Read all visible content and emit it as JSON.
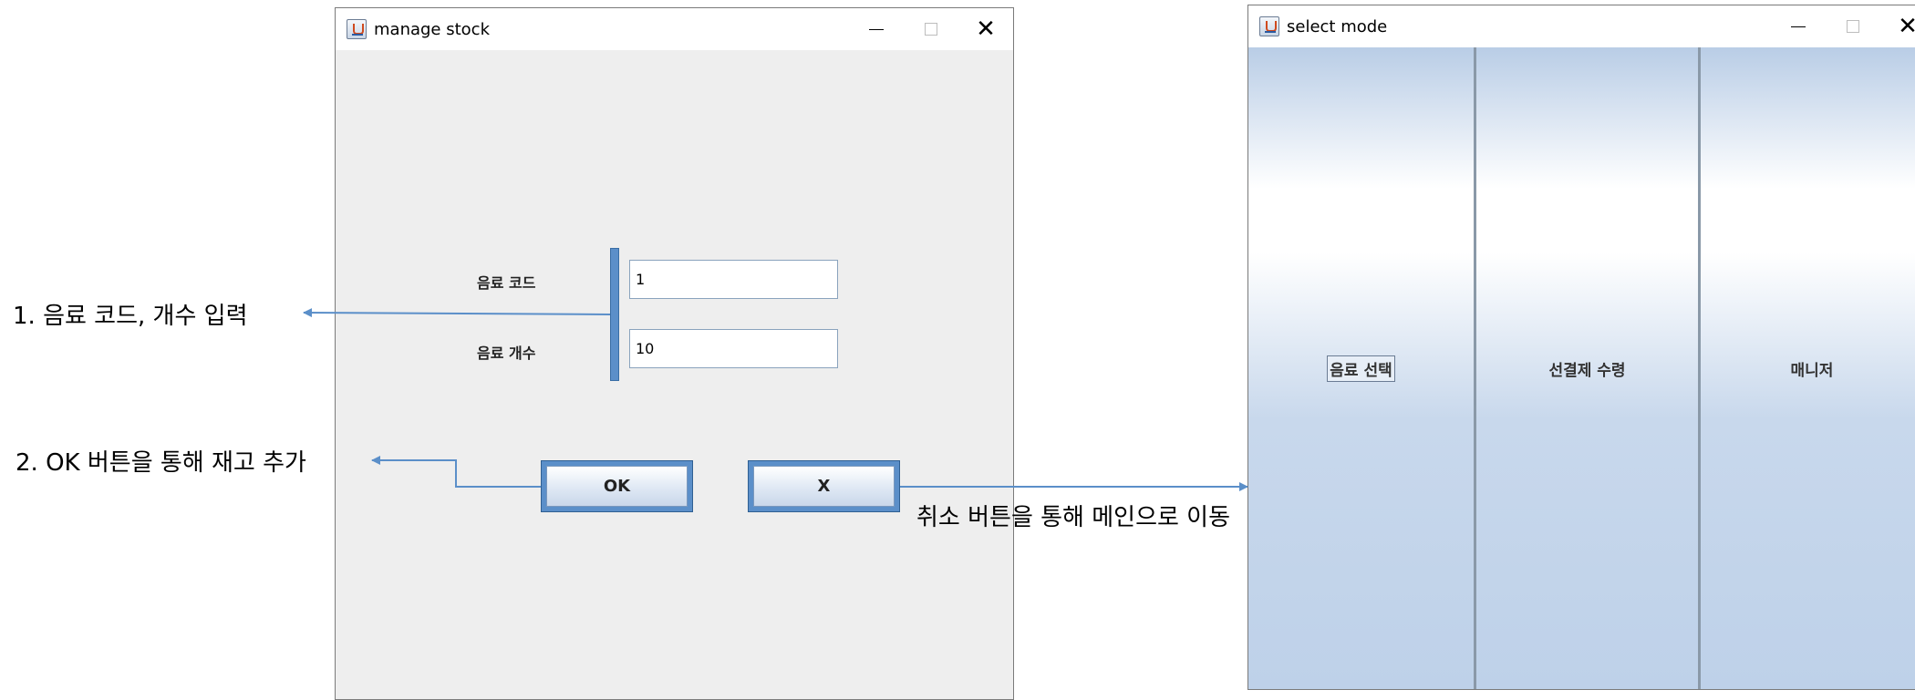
{
  "manage_window": {
    "title": "manage stock",
    "label_code": "음료 코드",
    "label_count": "음료 개수",
    "code_value": "1",
    "count_value": "10",
    "ok_label": "OK",
    "cancel_label": "X"
  },
  "select_window": {
    "title": "select mode",
    "modes": [
      "음료 선택",
      "선결제 수령",
      "매니저"
    ]
  },
  "annotations": {
    "step1": "1. 음료 코드, 개수 입력",
    "step2": "2. OK 버튼을 통해 재고 추가",
    "step3": "취소 버튼을 통해 메인으로 이동"
  },
  "colors": {
    "accent": "#5b8fc9",
    "arrow": "#5b8fc9",
    "window_bg": "#eeeeee"
  },
  "icons": {
    "app_icon": "java-cup-icon",
    "minimize": "minimize-icon",
    "maximize": "maximize-icon",
    "close": "close-icon"
  }
}
